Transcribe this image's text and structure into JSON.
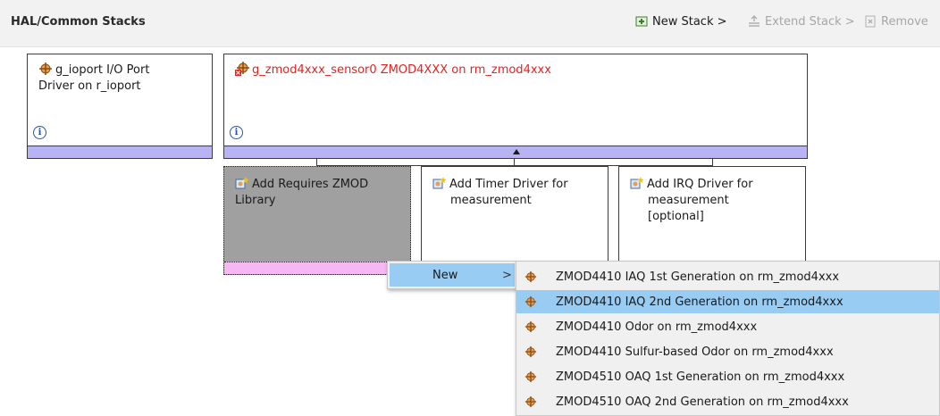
{
  "header": {
    "title": "HAL/Common Stacks",
    "new_stack": "New Stack >",
    "extend_stack": "Extend Stack >",
    "remove": "Remove"
  },
  "stacks": {
    "ioport": {
      "line1": "g_ioport I/O Port",
      "line2": "Driver on r_ioport",
      "info": "i"
    },
    "sensor": {
      "label": "g_zmod4xxx_sensor0 ZMOD4XXX on rm_zmod4xxx",
      "info": "i"
    },
    "require_lib": {
      "line1": "Add Requires ZMOD",
      "line2": "Library"
    },
    "timer": {
      "line1": "Add Timer Driver for",
      "line2": "measurement"
    },
    "irq": {
      "line1": "Add IRQ Driver for",
      "line2": "measurement",
      "line3": "[optional]"
    }
  },
  "context_menu": {
    "new_label": "New",
    "arrow": ">"
  },
  "submenu": {
    "items": [
      "ZMOD4410 IAQ 1st Generation on rm_zmod4xxx",
      "ZMOD4410 IAQ 2nd Generation on rm_zmod4xxx",
      "ZMOD4410 Odor on rm_zmod4xxx",
      "ZMOD4410 Sulfur-based Odor on rm_zmod4xxx",
      "ZMOD4510 OAQ 1st Generation on rm_zmod4xxx",
      "ZMOD4510 OAQ 2nd Generation on rm_zmod4xxx"
    ],
    "highlighted_index": 1
  },
  "colors": {
    "error_text": "#e8201e",
    "bar": "#b8b4f4",
    "highlight": "#99ccf2",
    "pink_bar": "#f5b8f2"
  }
}
